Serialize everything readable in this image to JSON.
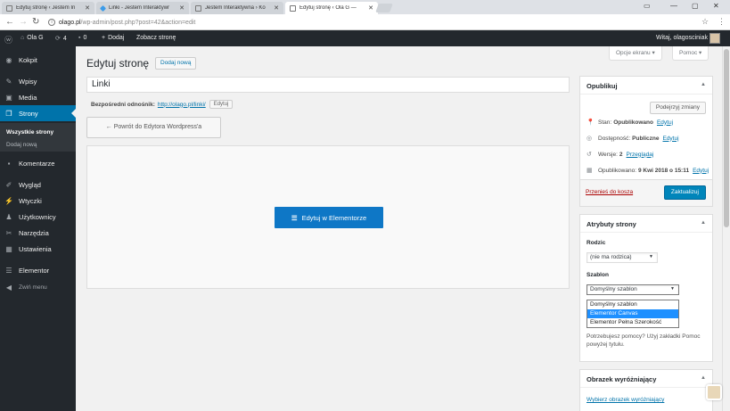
{
  "browser": {
    "tabs": [
      {
        "label": "Edytuj stronę ‹ Jestem In",
        "icon": "page-icon",
        "active": false
      },
      {
        "label": "Linki - Jestem Interaktywr",
        "icon": "elementor-icon",
        "active": false
      },
      {
        "label": "Jestem Interaktywna › Ko",
        "icon": "page-icon",
        "active": false
      },
      {
        "label": "Edytuj stronę ‹ Ola G —",
        "icon": "page-icon",
        "active": true
      }
    ],
    "url_host": "olago.pl",
    "url_path": "/wp-admin/post.php?post=42&action=edit"
  },
  "adminbar": {
    "site_name": "Ola G",
    "updates": "4",
    "comments": "0",
    "add_new": "Dodaj",
    "view_page": "Zobacz stronę",
    "greeting": "Witaj, olagosciniak"
  },
  "sidebar": {
    "items": [
      {
        "label": "Kokpit",
        "icon": "dashboard-icon"
      },
      {
        "label": "Wpisy",
        "icon": "pin-icon"
      },
      {
        "label": "Media",
        "icon": "media-icon"
      },
      {
        "label": "Strony",
        "icon": "pages-icon"
      },
      {
        "label": "Komentarze",
        "icon": "comments-icon"
      },
      {
        "label": "Wygląd",
        "icon": "brush-icon"
      },
      {
        "label": "Wtyczki",
        "icon": "plugin-icon"
      },
      {
        "label": "Użytkownicy",
        "icon": "users-icon"
      },
      {
        "label": "Narzędzia",
        "icon": "wrench-icon"
      },
      {
        "label": "Ustawienia",
        "icon": "settings-icon"
      },
      {
        "label": "Elementor",
        "icon": "elementor-icon"
      },
      {
        "label": "Zwiń menu",
        "icon": "collapse-icon"
      }
    ],
    "submenu": [
      "Wszystkie strony",
      "Dodaj nową"
    ]
  },
  "screen_options": "Opcje ekranu",
  "help": "Pomoc",
  "page": {
    "title": "Edytuj stronę",
    "add_new": "Dodaj nową",
    "post_title": "Linki",
    "permalink_label": "Bezpośredni odnośnik:",
    "permalink_url": "http://olago.pl/linki/",
    "permalink_edit": "Edytuj",
    "back_button": "← Powrót do Edytora Wordpress'a",
    "elementor_button": "Edytuj w Elementorze"
  },
  "publish": {
    "heading": "Opublikuj",
    "preview": "Podejrzyj zmiany",
    "status_label": "Stan:",
    "status_value": "Opublikowano",
    "status_edit": "Edytuj",
    "visibility_label": "Dostępność:",
    "visibility_value": "Publiczne",
    "visibility_edit": "Edytuj",
    "revisions_label": "Wersje:",
    "revisions_value": "2",
    "revisions_link": "Przeglądaj",
    "published_label": "Opublikowano:",
    "published_value": "9 Kwi 2018 o 15:11",
    "published_edit": "Edytuj",
    "trash": "Przenieś do kosza",
    "update": "Zaktualizuj"
  },
  "attributes": {
    "heading": "Atrybuty strony",
    "parent_label": "Rodzic",
    "parent_value": "(nie ma rodzica)",
    "template_label": "Szablon",
    "template_value": "Domyślny szablon",
    "template_options": [
      "Domyślny szablon",
      "Elementor Canvas",
      "Elementor Pełna Szerokość"
    ],
    "highlighted_option": 1,
    "help_text": "Potrzebujesz pomocy? Użyj zakładki Pomoc powyżej tytułu."
  },
  "featured": {
    "heading": "Obrazek wyróżniający",
    "link": "Wybierz obrazek wyróżniający"
  },
  "colors": {
    "accent": "#0073aa",
    "elementor": "#0e77c6",
    "admin_dark": "#23282d"
  }
}
